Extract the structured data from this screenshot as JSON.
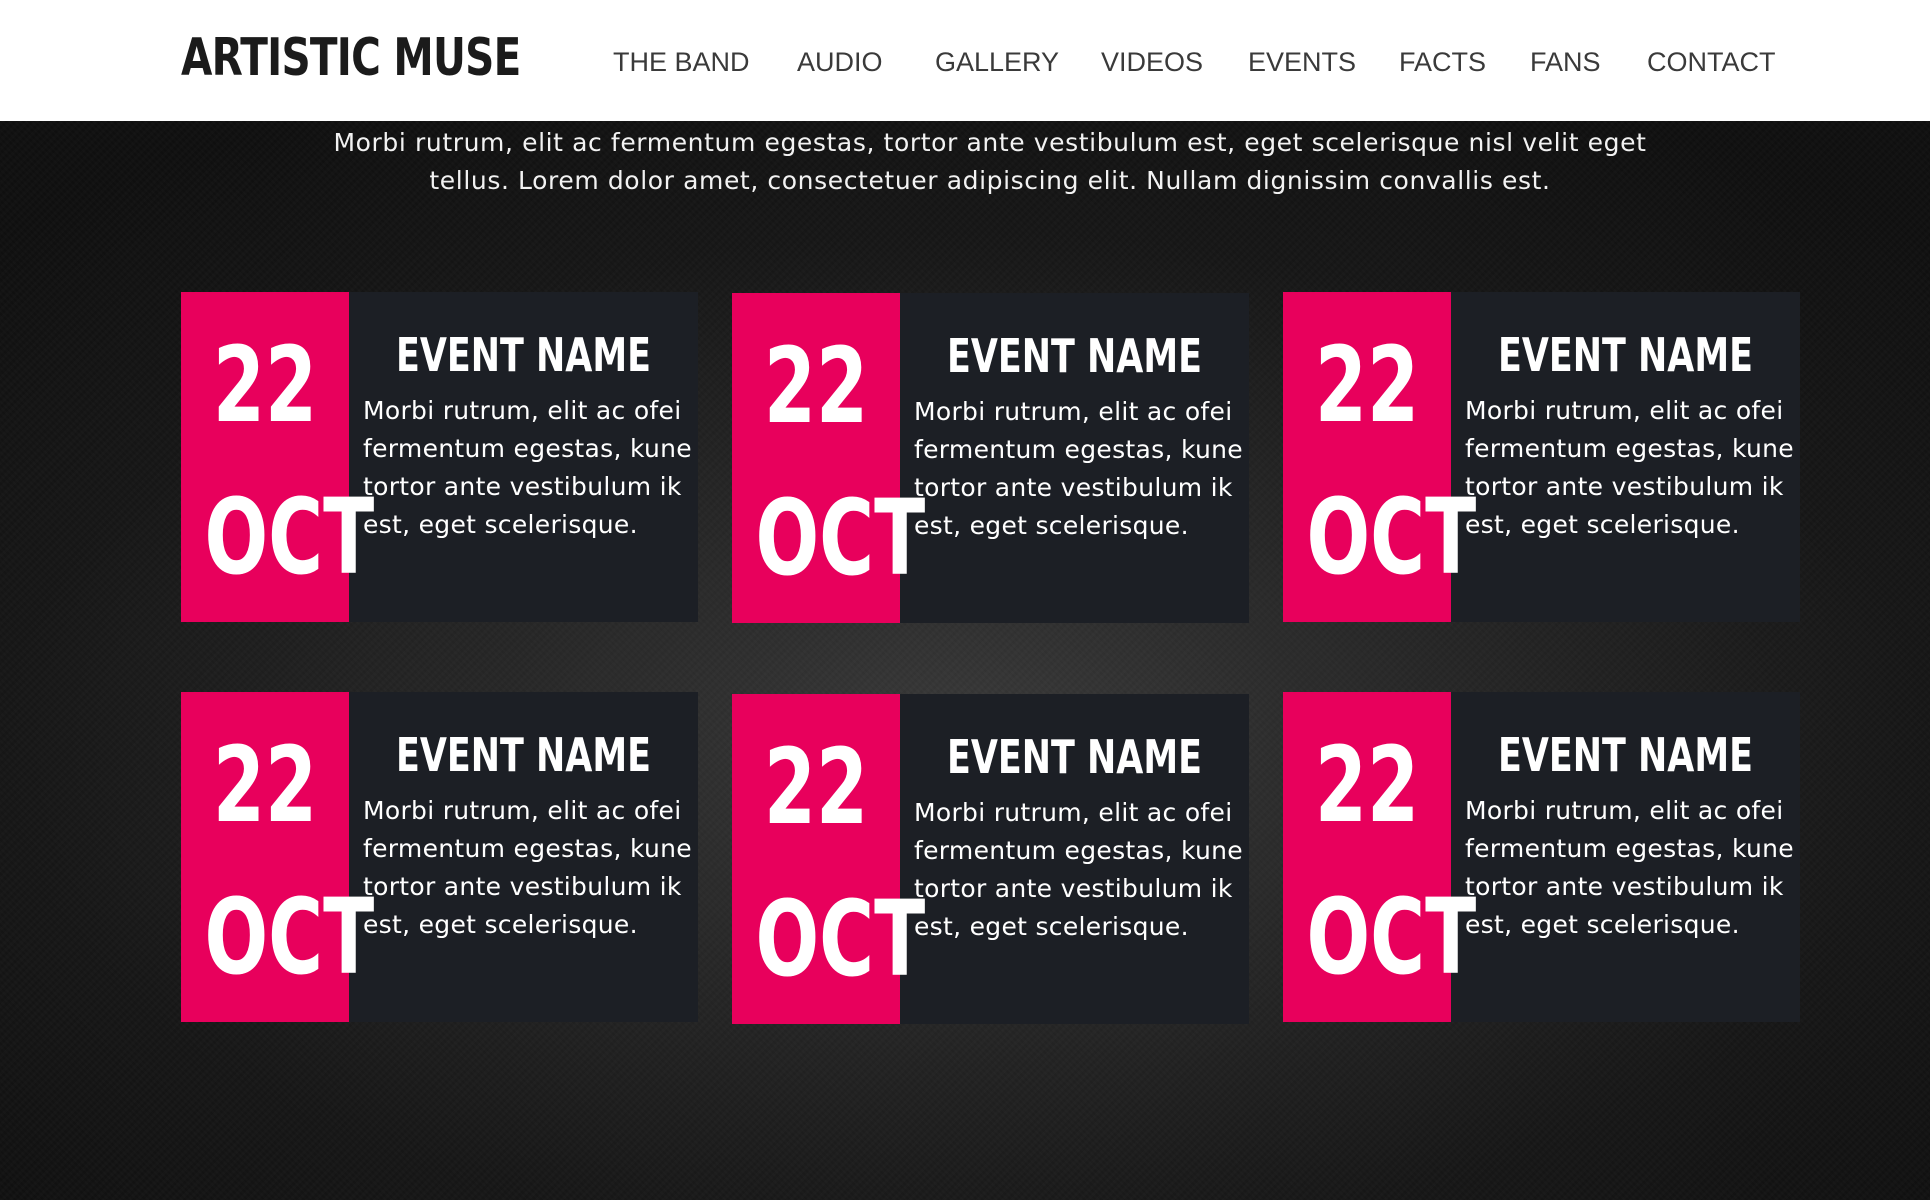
{
  "header": {
    "logo": "ARTISTIC MUSE",
    "nav": [
      {
        "label": "THE BAND",
        "name": "nav-the-band"
      },
      {
        "label": "AUDIO",
        "name": "nav-audio"
      },
      {
        "label": "GALLERY",
        "name": "nav-gallery"
      },
      {
        "label": "VIDEOS",
        "name": "nav-videos"
      },
      {
        "label": "EVENTS",
        "name": "nav-events"
      },
      {
        "label": "FACTS",
        "name": "nav-facts"
      },
      {
        "label": "FANS",
        "name": "nav-fans"
      },
      {
        "label": "CONTACT",
        "name": "nav-contact"
      }
    ]
  },
  "intro": "Morbi rutrum, elit ac fermentum egestas, tortor ante vestibulum est, eget scelerisque nisl velit eget tellus. Lorem dolor amet, consectetuer adipiscing elit. Nullam dignissim convallis est.",
  "events": [
    {
      "day": "22",
      "month": "OCT",
      "title": "EVENT NAME",
      "description": "Morbi rutrum, elit ac ofei fermentum egestas, kune tortor ante vestibulum ik est, eget scelerisque."
    },
    {
      "day": "22",
      "month": "OCT",
      "title": "EVENT NAME",
      "description": "Morbi rutrum, elit ac ofei fermentum egestas, kune tortor ante vestibulum ik est, eget scelerisque."
    },
    {
      "day": "22",
      "month": "OCT",
      "title": "EVENT NAME",
      "description": "Morbi rutrum, elit ac ofei fermentum egestas, kune tortor ante vestibulum ik est, eget scelerisque."
    },
    {
      "day": "22",
      "month": "OCT",
      "title": "EVENT NAME",
      "description": "Morbi rutrum, elit ac ofei fermentum egestas, kune tortor ante vestibulum ik est, eget scelerisque."
    },
    {
      "day": "22",
      "month": "OCT",
      "title": "EVENT NAME",
      "description": "Morbi rutrum, elit ac ofei fermentum egestas, kune tortor ante vestibulum ik est, eget scelerisque."
    },
    {
      "day": "22",
      "month": "OCT",
      "title": "EVENT NAME",
      "description": "Morbi rutrum, elit ac ofei fermentum egestas, kune tortor ante vestibulum ik est, eget scelerisque."
    }
  ],
  "colors": {
    "accent": "#e8005c",
    "card_background": "#1c1f25",
    "header_background": "#ffffff"
  }
}
